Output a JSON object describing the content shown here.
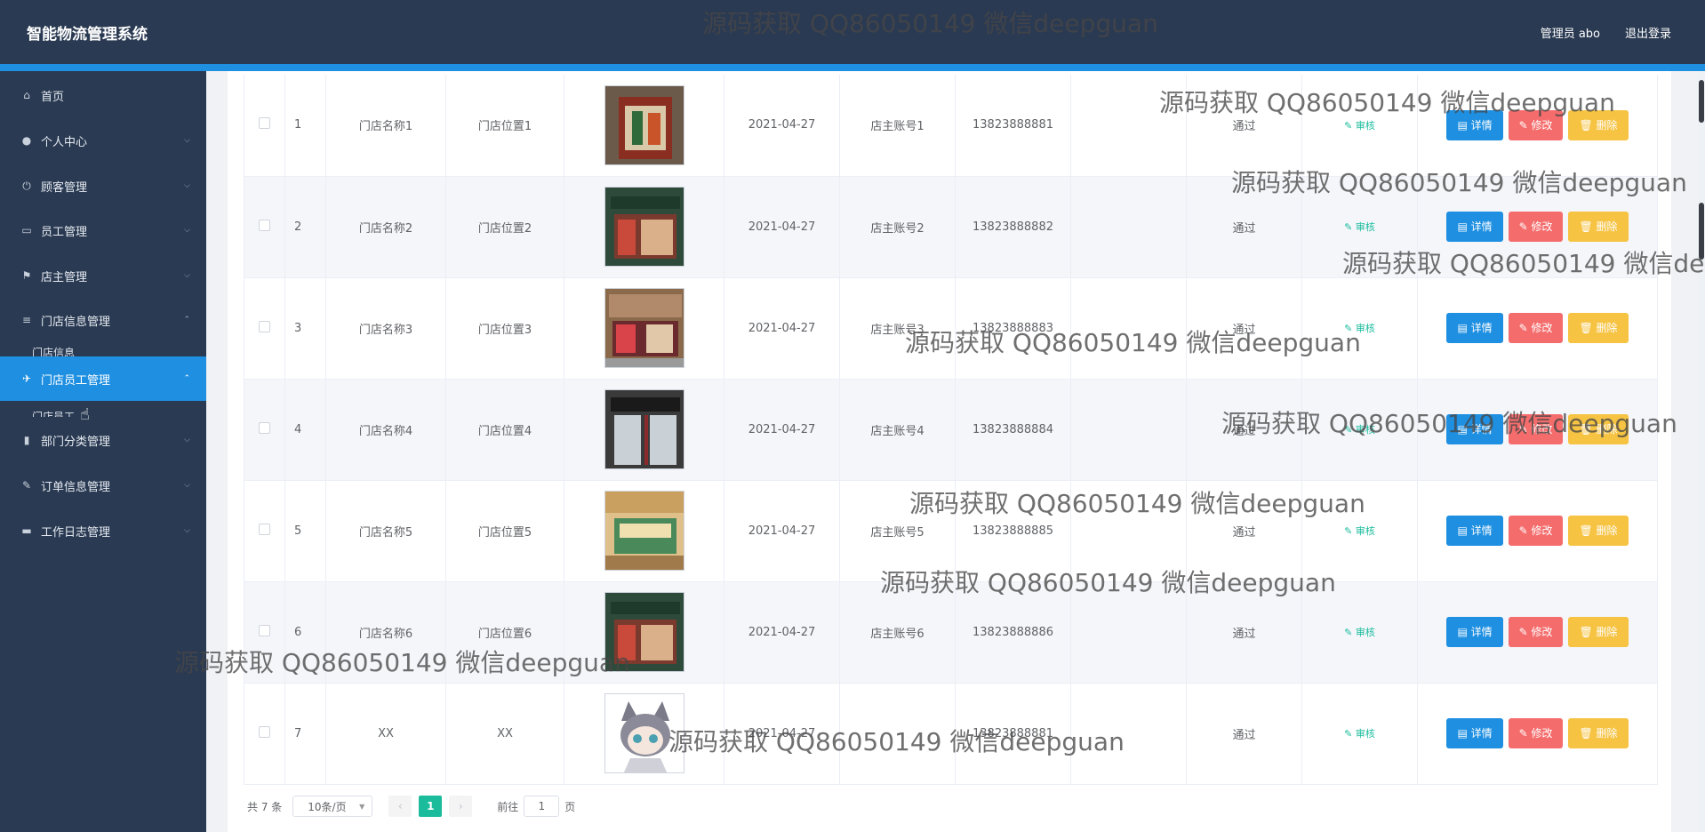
{
  "header": {
    "title": "智能物流管理系统",
    "user": "管理员 abo",
    "logout": "退出登录"
  },
  "sidebar": {
    "items": [
      {
        "icon": "⌂",
        "label": "首页",
        "chev": ""
      },
      {
        "icon": "●",
        "label": "个人中心",
        "chev": "⌵"
      },
      {
        "icon": "⏻",
        "label": "顾客管理",
        "chev": "⌵"
      },
      {
        "icon": "▭",
        "label": "员工管理",
        "chev": "⌵"
      },
      {
        "icon": "⚑",
        "label": "店主管理",
        "chev": "⌵"
      },
      {
        "icon": "≡",
        "label": "门店信息管理",
        "chev": "⌃"
      },
      {
        "icon": "✈",
        "label": "门店员工管理",
        "chev": "⌃"
      },
      {
        "icon": "▮",
        "label": "部门分类管理",
        "chev": "⌵"
      },
      {
        "icon": "✎",
        "label": "订单信息管理",
        "chev": "⌵"
      },
      {
        "icon": "▬",
        "label": "工作日志管理",
        "chev": "⌵"
      }
    ],
    "sub1": "门店信息",
    "sub2": "门店员工"
  },
  "table": {
    "rows": [
      {
        "no": "1",
        "name": "门店名称1",
        "location": "门店位置1",
        "date": "2021-04-27",
        "owner": "店主账号1",
        "phone": "13823888881",
        "status": "通过"
      },
      {
        "no": "2",
        "name": "门店名称2",
        "location": "门店位置2",
        "date": "2021-04-27",
        "owner": "店主账号2",
        "phone": "13823888882",
        "status": "通过"
      },
      {
        "no": "3",
        "name": "门店名称3",
        "location": "门店位置3",
        "date": "2021-04-27",
        "owner": "店主账号3",
        "phone": "13823888883",
        "status": "通过"
      },
      {
        "no": "4",
        "name": "门店名称4",
        "location": "门店位置4",
        "date": "2021-04-27",
        "owner": "店主账号4",
        "phone": "13823888884",
        "status": "通过"
      },
      {
        "no": "5",
        "name": "门店名称5",
        "location": "门店位置5",
        "date": "2021-04-27",
        "owner": "店主账号5",
        "phone": "13823888885",
        "status": "通过"
      },
      {
        "no": "6",
        "name": "门店名称6",
        "location": "门店位置6",
        "date": "2021-04-27",
        "owner": "店主账号6",
        "phone": "13823888886",
        "status": "通过"
      },
      {
        "no": "7",
        "name": "XX",
        "location": "XX",
        "date": "2021-04-27",
        "owner": "",
        "phone": "13823888881",
        "status": "通过"
      }
    ],
    "audit_label": "✎ 审核",
    "detail_label": "▤ 详情",
    "edit_label": "✎ 修改",
    "delete_label": "🗑 删除"
  },
  "pagination": {
    "total": "共 7 条",
    "page_size": "10条/页",
    "current": "1",
    "goto": "前往",
    "goto_value": "1",
    "page_suffix": "页"
  },
  "watermark": "源码获取 QQ86050149 微信deepguan",
  "colors": {
    "topbar": "#2a3a52",
    "accent": "#1e8fe1",
    "danger": "#f56c6c",
    "warning": "#f6c343",
    "success": "#1abc9c"
  }
}
